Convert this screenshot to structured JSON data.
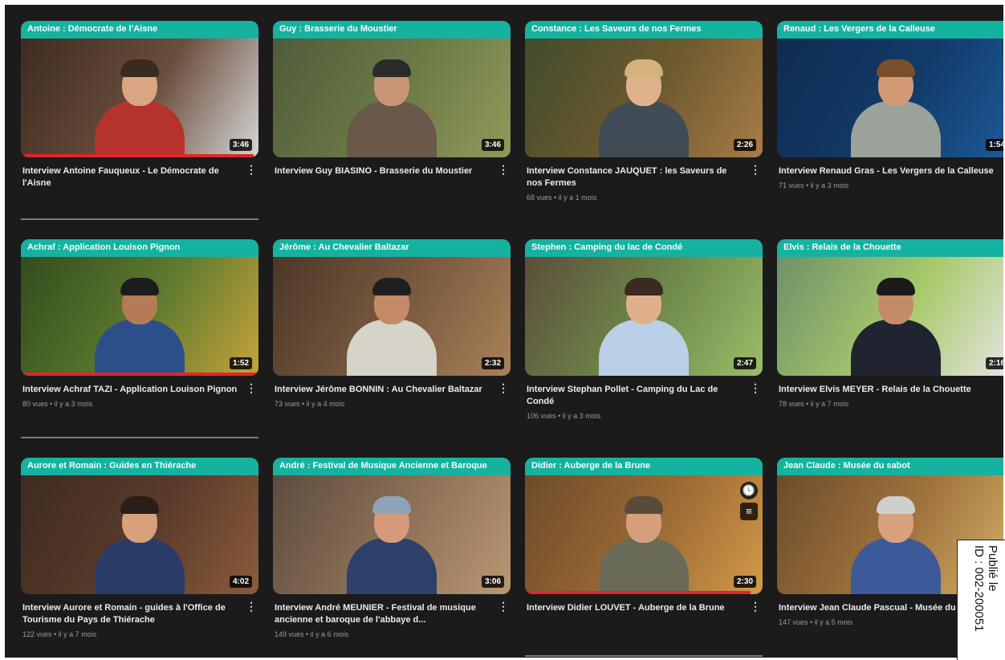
{
  "videos": [
    {
      "banner": "Antoine : Démocrate de l'Aisne",
      "title": "Interview Antoine Fauqueux - Le Démocrate de l'Aisne",
      "stats": "",
      "duration": "3:46",
      "watched": 0.98,
      "bg": [
        "#3b2a20",
        "#6a4d3c",
        "#d6d6d6"
      ],
      "torso": "#b6322c",
      "skin": "#d9a583",
      "hair": "#3a2a20"
    },
    {
      "banner": "Guy : Brasserie du Moustier",
      "title": "Interview Guy BIASINO - Brasserie du Moustier",
      "stats": "",
      "duration": "3:46",
      "watched": 0,
      "bg": [
        "#4d5a3a",
        "#6d7b47",
        "#8f9a5a"
      ],
      "torso": "#6a584a",
      "skin": "#c99677",
      "hair": "#2a2a2a"
    },
    {
      "banner": "Constance : Les Saveurs de nos Fermes",
      "title": "Interview Constance JAUQUET : les Saveurs de nos Fermes",
      "stats": "68 vues • il y a 1 mois",
      "duration": "2:26",
      "watched": 0,
      "bg": [
        "#3f4b2c",
        "#6e5a2f",
        "#a77c46"
      ],
      "torso": "#3f4b55",
      "skin": "#e0b28c",
      "hair": "#d3b27b"
    },
    {
      "banner": "Renaud : Les Vergers de la Calleuse",
      "title": "Interview Renaud Gras - Les Vergers de la Calleuse",
      "stats": "71 vues • il y a 3 mois",
      "duration": "1:54",
      "watched": 0,
      "bg": [
        "#0f2a4f",
        "#123b6a",
        "#1d5a99"
      ],
      "torso": "#9aa29a",
      "skin": "#d49a76",
      "hair": "#7a4f2e"
    },
    {
      "banner": "Achraf : Application Louison Pignon",
      "title": "Interview Achraf TAZI - Application Louison Pignon",
      "stats": "80 vues • il y a 3 mois",
      "duration": "1:52",
      "watched": 1.0,
      "bg": [
        "#2f4a1c",
        "#5e7b2f",
        "#c8a23b"
      ],
      "torso": "#2c4f8a",
      "skin": "#b57b56",
      "hair": "#1d1d1d"
    },
    {
      "banner": "Jérôme : Au Chevalier Baltazar",
      "title": "Interview Jérôme BONNIN : Au Chevalier Baltazar",
      "stats": "73 vues • il y a 4 mois",
      "duration": "2:32",
      "watched": 0,
      "bg": [
        "#4a3526",
        "#7a5b40",
        "#a98158"
      ],
      "torso": "#d6d3c8",
      "skin": "#c58b67",
      "hair": "#1f1f1f"
    },
    {
      "banner": "Stephen : Camping du lac de Condé",
      "title": "Interview Stephan Pollet - Camping du Lac de Condé",
      "stats": "106 vues • il y a 3 mois",
      "duration": "2:47",
      "watched": 0,
      "bg": [
        "#5a4a3a",
        "#6f8a4a",
        "#9cbc6a"
      ],
      "torso": "#b9d0e8",
      "skin": "#e0b08b",
      "hair": "#3a2a20"
    },
    {
      "banner": "Elvis : Relais de la Chouette",
      "title": "Interview Elvis MEYER - Relais de la Chouette",
      "stats": "78 vues • il y a 7 mois",
      "duration": "2:16",
      "watched": 0,
      "bg": [
        "#6a8e6a",
        "#a9c96b",
        "#e6e6e6"
      ],
      "torso": "#1f2430",
      "skin": "#c58b67",
      "hair": "#1a1a1a"
    },
    {
      "banner": "Aurore et Romain : Guides en Thiérache",
      "title": "Interview Aurore et Romain - guides à l'Office de Tourisme du Pays de Thiérache",
      "stats": "122 vues • il y a 7 mois",
      "duration": "4:02",
      "watched": 0,
      "bg": [
        "#3c2a21",
        "#5b3b2b",
        "#8b5b3b"
      ],
      "torso": "#2a3b6a",
      "skin": "#d8a07b",
      "hair": "#2a1e18"
    },
    {
      "banner": "André : Festival de Musique Ancienne et Baroque",
      "title": "Interview André MEUNIER - Festival de musique ancienne et baroque de l'abbaye d...",
      "stats": "149 vues • il y a 6 mois",
      "duration": "3:06",
      "watched": 0,
      "bg": [
        "#5a4a3d",
        "#8f7258",
        "#b99773"
      ],
      "torso": "#2d3f6b",
      "skin": "#d69a7a",
      "hair": "#8fa3b8"
    },
    {
      "banner": "Didier : Auberge de la Brune",
      "title": "Interview Didier LOUVET - Auberge de la Brune",
      "stats": "",
      "duration": "2:30",
      "watched": 0.95,
      "bg": [
        "#6b4a2a",
        "#9c6a34",
        "#d39a4a"
      ],
      "torso": "#6a6a58",
      "skin": "#d4a07c",
      "hair": "#5a4a3a",
      "icons": true
    },
    {
      "banner": "Jean Claude : Musée du sabot",
      "title": "Interview Jean Claude Pascual - Musée du Sabot",
      "stats": "147 vues • il y a 5 mois",
      "duration": "",
      "watched": 0,
      "bg": [
        "#6a4a2a",
        "#a1743d",
        "#d8b26a"
      ],
      "torso": "#3c5a9a",
      "skin": "#d9a27f",
      "hair": "#cfcfcf"
    }
  ],
  "stamp": {
    "line1": "Publié le",
    "line2": "ID : 002-200051"
  },
  "icons": {
    "menu": "⋮",
    "clock": "🕓",
    "queue": "≡"
  }
}
